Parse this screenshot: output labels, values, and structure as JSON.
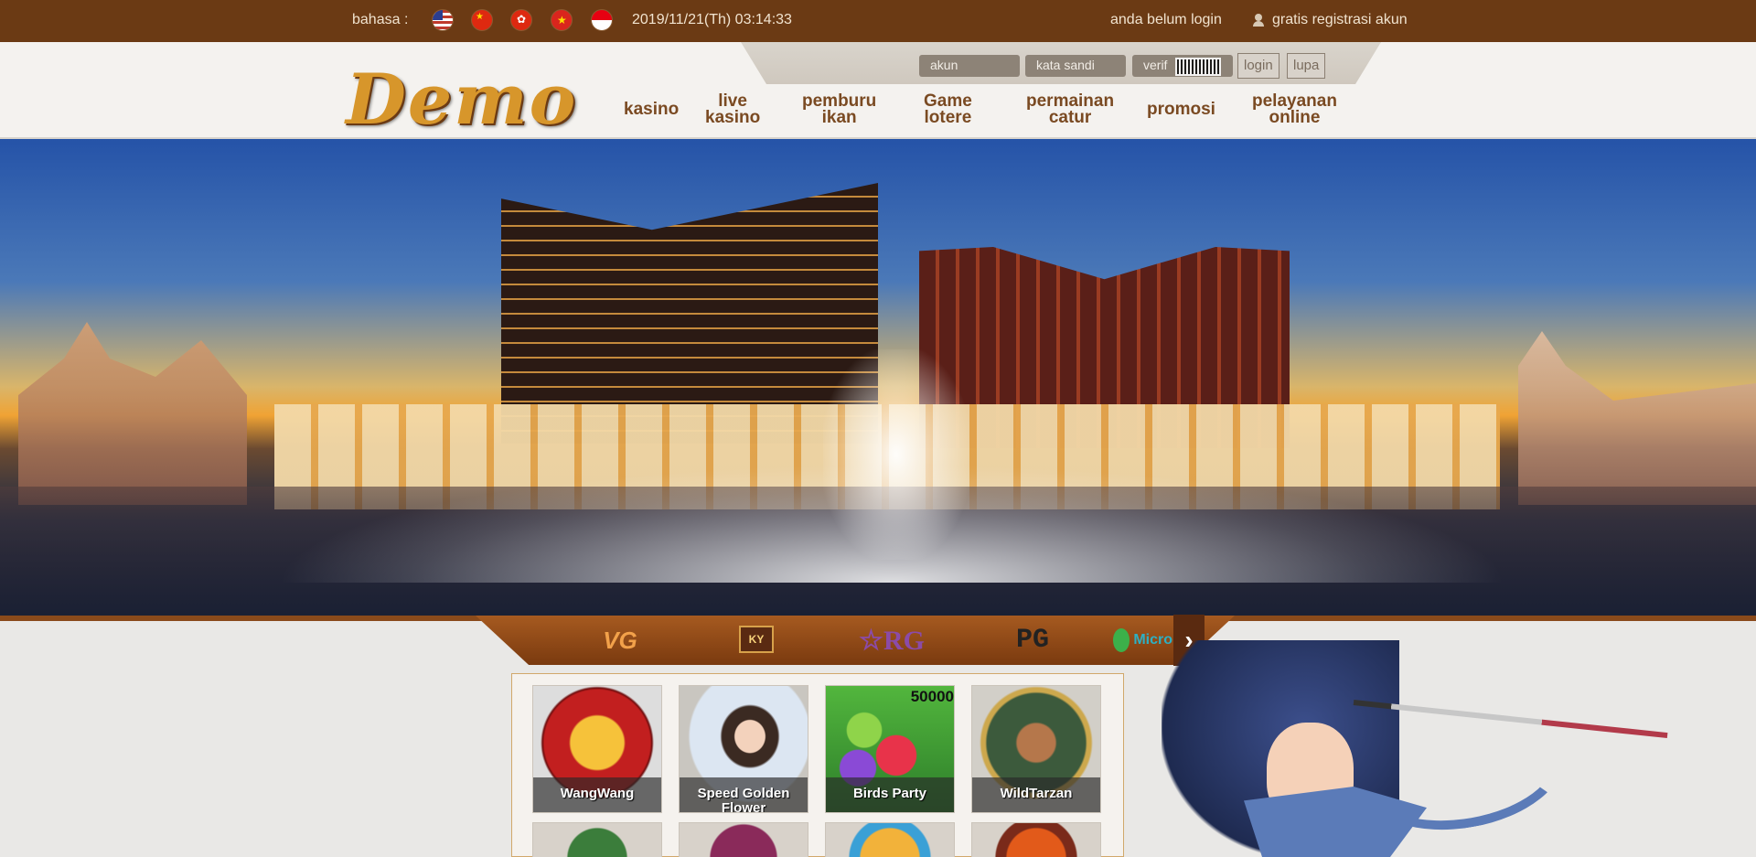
{
  "topbar": {
    "language_label": "bahasa :",
    "flags": [
      "us-flag-icon",
      "china-flag-icon",
      "hongkong-flag-icon",
      "vietnam-flag-icon",
      "indonesia-flag-icon"
    ],
    "datetime": "2019/11/21(Th) 03:14:33",
    "login_status": "anda belum login",
    "register": "gratis registrasi akun"
  },
  "login_form": {
    "account_placeholder": "akun",
    "password_placeholder": "kata sandi",
    "verify_placeholder": "verif",
    "login_button": "login",
    "forgot_button": "lupa"
  },
  "logo": "Demo",
  "nav": [
    {
      "line1": "kasino",
      "line2": ""
    },
    {
      "line1": "live",
      "line2": "kasino"
    },
    {
      "line1": "pemburu",
      "line2": "ikan"
    },
    {
      "line1": "Game",
      "line2": "lotere"
    },
    {
      "line1": "permainan",
      "line2": "catur"
    },
    {
      "line1": "promosi",
      "line2": ""
    },
    {
      "line1": "pelayanan",
      "line2": "online"
    }
  ],
  "providers": {
    "vg": "VG",
    "ky": "KY",
    "rg": "☆RG",
    "pg": "PG",
    "micro": "Micro"
  },
  "games": [
    {
      "name": "WangWang"
    },
    {
      "name": "Speed Golden Flower"
    },
    {
      "name": "Birds Party"
    },
    {
      "name": "WildTarzan"
    }
  ],
  "birds_party_badge": "50000",
  "colors": {
    "topbar_bg": "#6b3a14",
    "nav_text": "#7a4a22",
    "logo_gold": "#d7962b"
  }
}
